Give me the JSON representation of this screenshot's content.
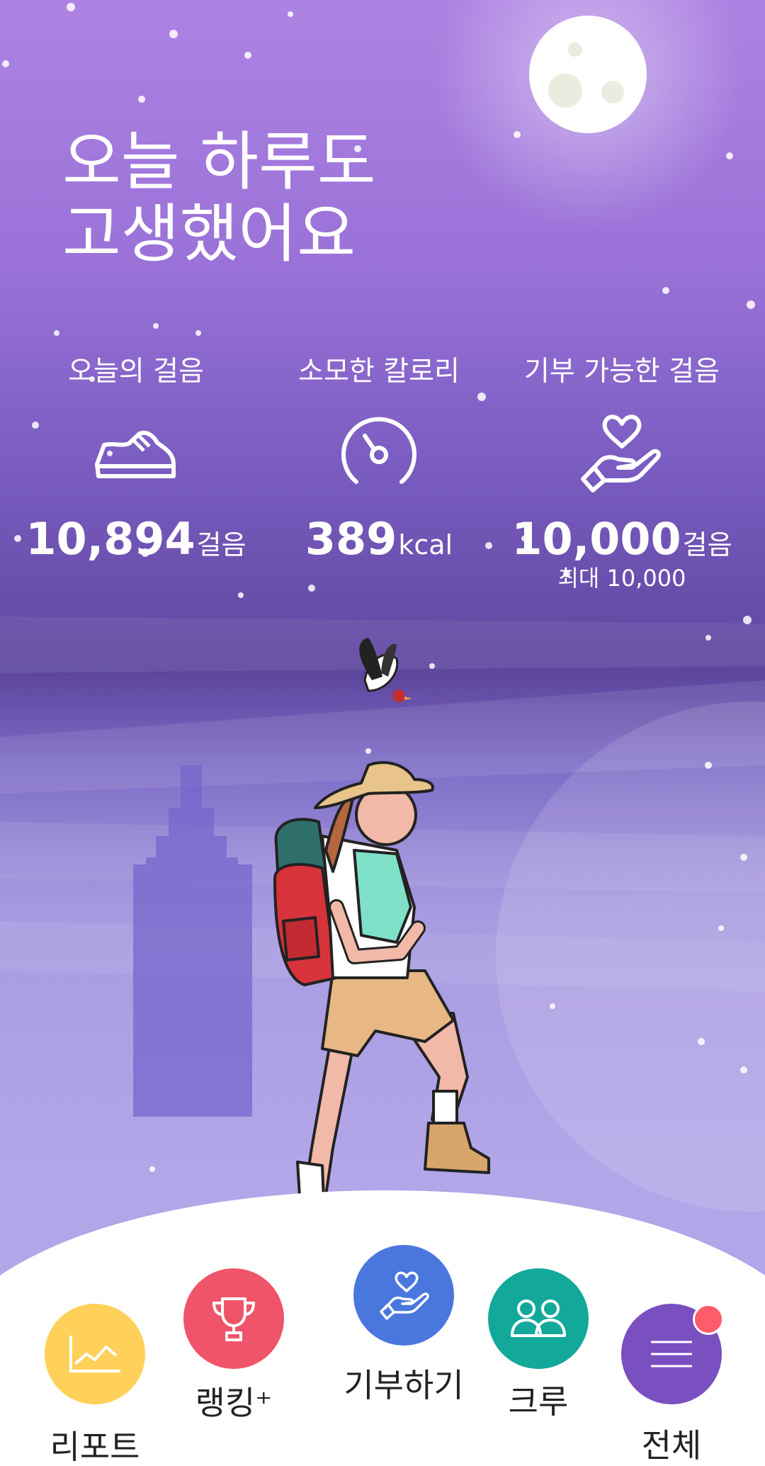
{
  "headline": {
    "line1": "오늘 하루도",
    "line2": "고생했어요"
  },
  "stats": [
    {
      "label": "오늘의 걸음",
      "icon": "sneaker-icon",
      "value": "10,894",
      "unit": "걸음"
    },
    {
      "label": "소모한 칼로리",
      "icon": "gauge-icon",
      "value": "389",
      "unit": "kcal"
    },
    {
      "label": "기부 가능한 걸음",
      "icon": "heart-hand-icon",
      "value": "10,000",
      "unit": "걸음",
      "sub": "최대 10,000"
    }
  ],
  "nav": [
    {
      "label": "리포트",
      "icon": "chart-icon",
      "color": "#ffd15a"
    },
    {
      "label": "랭킹⁺",
      "icon": "trophy-icon",
      "color": "#f0546a"
    },
    {
      "label": "기부하기",
      "icon": "donate-icon",
      "color": "#4a77de"
    },
    {
      "label": "크루",
      "icon": "crew-icon",
      "color": "#12a99a"
    },
    {
      "label": "전체",
      "icon": "menu-icon",
      "color": "#7a4fc0"
    }
  ],
  "colors": {
    "notification": "#ff5c6b"
  }
}
